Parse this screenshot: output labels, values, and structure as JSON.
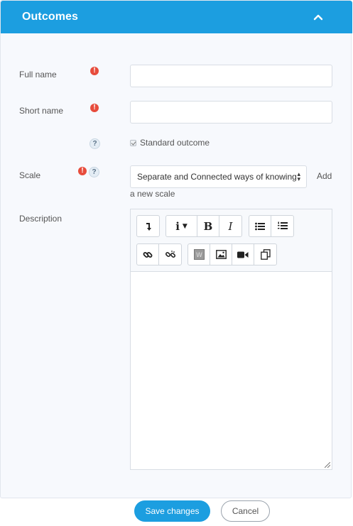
{
  "header": {
    "title": "Outcomes"
  },
  "form": {
    "full_name_label": "Full name",
    "full_name_value": "",
    "short_name_label": "Short name",
    "short_name_value": "",
    "standard_outcome_label": "Standard outcome",
    "standard_outcome_checked": true,
    "scale_label": "Scale",
    "scale_selected": "Separate and Connected ways of knowing",
    "add_scale_part1": "Add",
    "add_scale_part2": "a new scale",
    "description_label": "Description",
    "required_icon": "!",
    "help_icon": "?"
  },
  "editor": {
    "bold": "B",
    "italic": "I",
    "info": "i",
    "content": ""
  },
  "actions": {
    "save_label": "Save changes",
    "cancel_label": "Cancel"
  },
  "colors": {
    "accent": "#1c9ee0",
    "required": "#e74c3c",
    "panel_bg": "#f7f9fd"
  }
}
